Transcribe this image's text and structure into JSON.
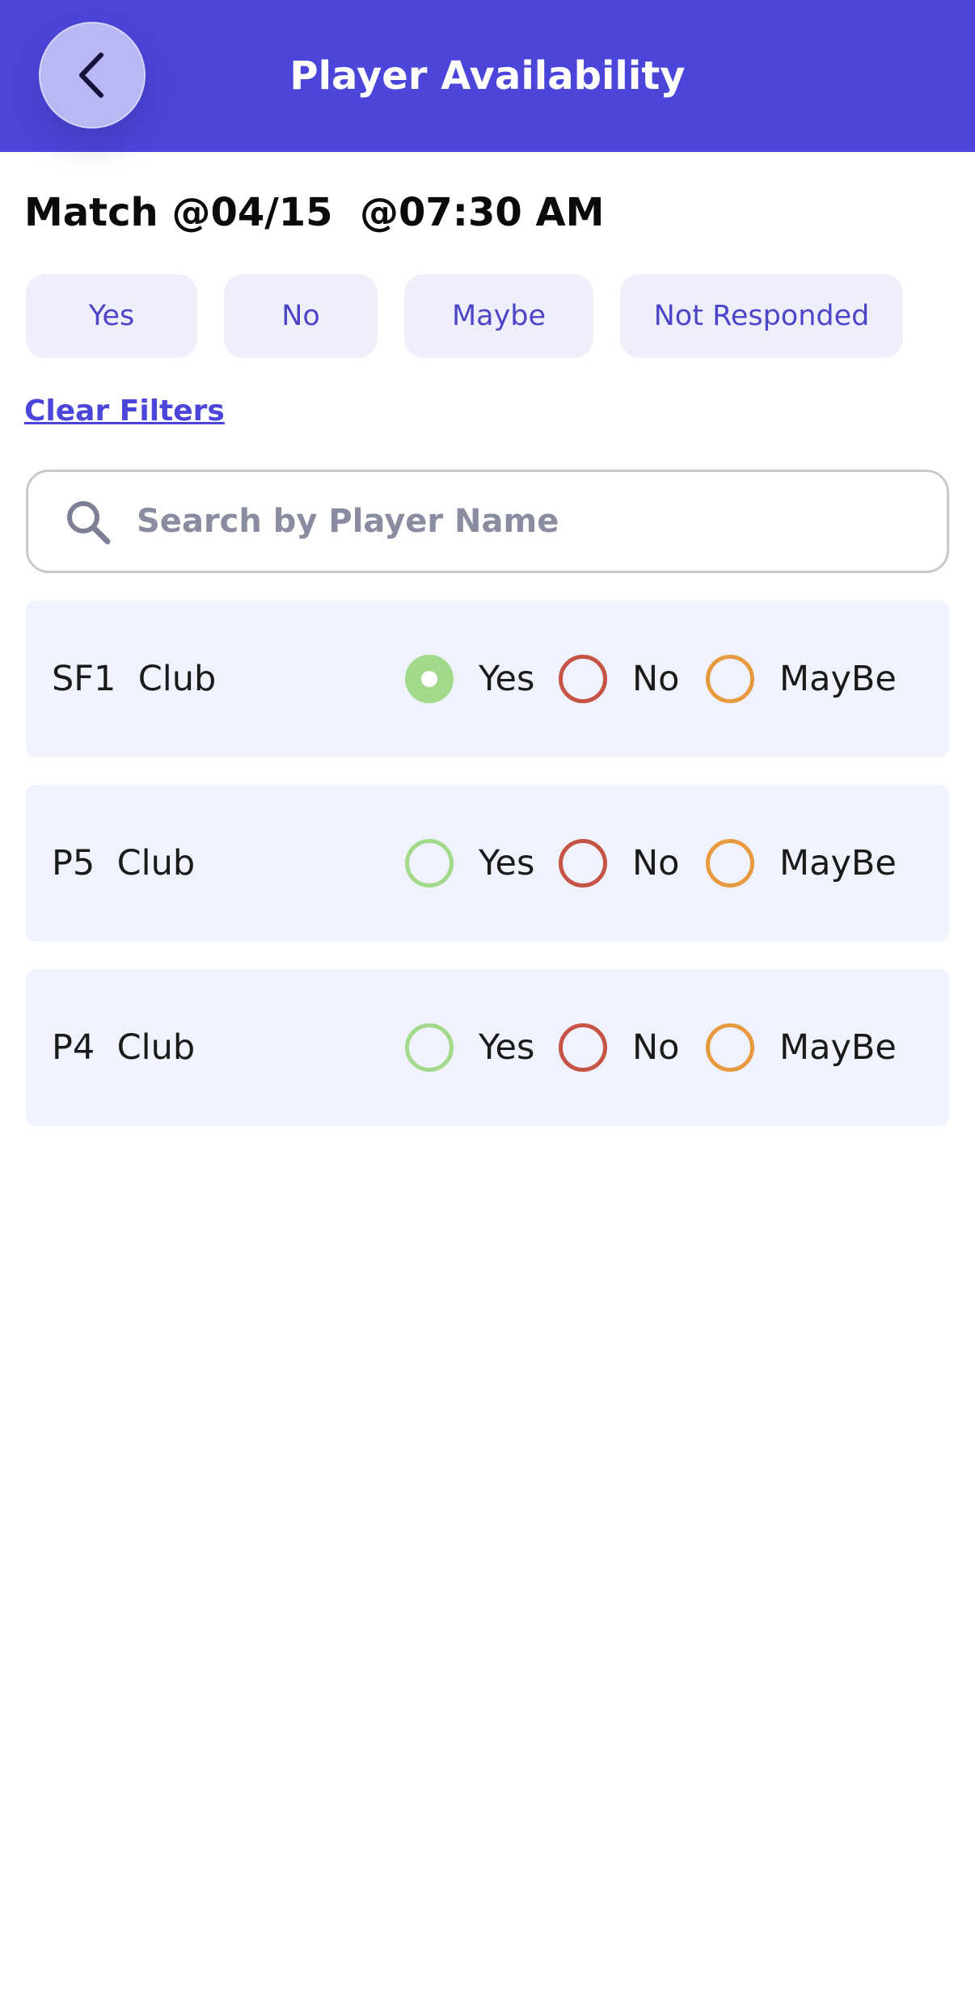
{
  "header": {
    "title": "Player Availability",
    "back_icon": "chevron-left-icon",
    "color": "#4c45da"
  },
  "match": {
    "title": "Match @04/15  @07:30 AM"
  },
  "filters": {
    "yes": "Yes",
    "no": "No",
    "maybe": "Maybe",
    "not_responded": "Not Responded",
    "clear": "Clear Filters"
  },
  "search": {
    "placeholder": "Search by Player Name",
    "value": "",
    "icon": "search-icon"
  },
  "players": [
    {
      "name": "SF1  Club",
      "selected": "yes",
      "yes": "Yes",
      "no": "No",
      "maybe": "MayBe"
    },
    {
      "name": "P5  Club",
      "selected": "",
      "yes": "Yes",
      "no": "No",
      "maybe": "MayBe"
    },
    {
      "name": "P4  Club",
      "selected": "",
      "yes": "Yes",
      "no": "No",
      "maybe": "MayBe"
    }
  ],
  "colors": {
    "yes": "#a3d98a",
    "no": "#c65444",
    "maybe": "#e89a40",
    "chip_bg": "#efeffb"
  }
}
